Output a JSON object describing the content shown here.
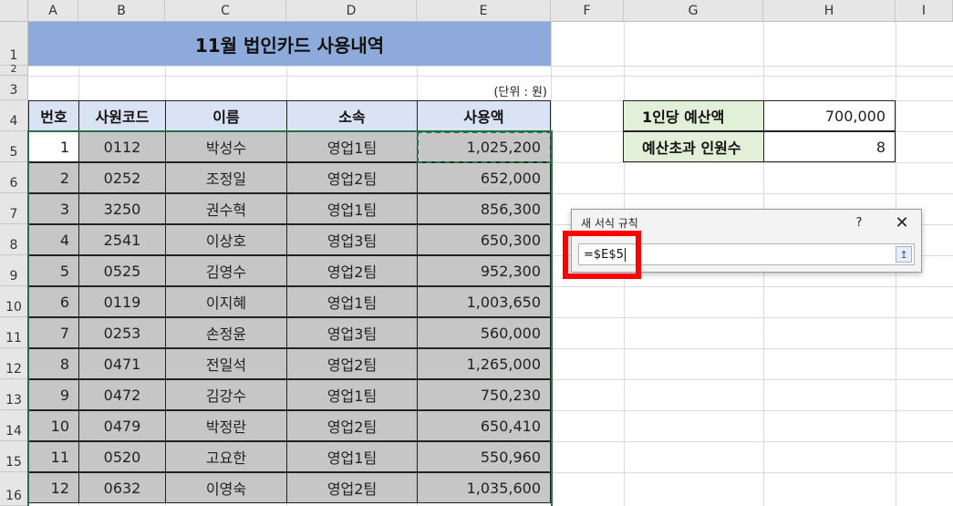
{
  "columns": [
    "A",
    "B",
    "C",
    "D",
    "E",
    "F",
    "G",
    "H",
    "I"
  ],
  "rows": [
    "1",
    "2",
    "3",
    "4",
    "5",
    "6",
    "7",
    "8",
    "9",
    "10",
    "11",
    "12",
    "13",
    "14",
    "15",
    "16"
  ],
  "sheet": {
    "title": "11월 법인카드 사용내역",
    "unit_note": "(단위 : 원)",
    "headers": [
      "번호",
      "사원코드",
      "이름",
      "소속",
      "사용액"
    ],
    "records": [
      {
        "no": "1",
        "code": "0112",
        "name": "박성수",
        "team": "영업1팀",
        "amount": "1,025,200"
      },
      {
        "no": "2",
        "code": "0252",
        "name": "조정일",
        "team": "영업2팀",
        "amount": "652,000"
      },
      {
        "no": "3",
        "code": "3250",
        "name": "권수혁",
        "team": "영업1팀",
        "amount": "856,300"
      },
      {
        "no": "4",
        "code": "2541",
        "name": "이상호",
        "team": "영업3팀",
        "amount": "650,300"
      },
      {
        "no": "5",
        "code": "0525",
        "name": "김영수",
        "team": "영업2팀",
        "amount": "952,300"
      },
      {
        "no": "6",
        "code": "0119",
        "name": "이지혜",
        "team": "영업1팀",
        "amount": "1,003,650"
      },
      {
        "no": "7",
        "code": "0253",
        "name": "손정윤",
        "team": "영업3팀",
        "amount": "560,000"
      },
      {
        "no": "8",
        "code": "0471",
        "name": "전일석",
        "team": "영업2팀",
        "amount": "1,265,000"
      },
      {
        "no": "9",
        "code": "0472",
        "name": "김강수",
        "team": "영업1팀",
        "amount": "750,230"
      },
      {
        "no": "10",
        "code": "0479",
        "name": "박정란",
        "team": "영업2팀",
        "amount": "650,410"
      },
      {
        "no": "11",
        "code": "0520",
        "name": "고요한",
        "team": "영업1팀",
        "amount": "550,960"
      },
      {
        "no": "12",
        "code": "0632",
        "name": "이영숙",
        "team": "영업2팀",
        "amount": "1,035,600"
      }
    ],
    "summary": {
      "budget_label": "1인당 예산액",
      "budget_value": "700,000",
      "over_label": "예산초과 인원수",
      "over_value": "8"
    }
  },
  "dialog": {
    "title": "새 서식 규칙",
    "help": "?",
    "close": "✕",
    "formula": "=$E$5",
    "collapse_icon": "↥"
  },
  "colors": {
    "title_fill": "#8eaadb",
    "header_fill": "#dae3f3",
    "summary_fill": "#e2efd9",
    "selection": "#217346",
    "highlight": "#ff0000"
  }
}
